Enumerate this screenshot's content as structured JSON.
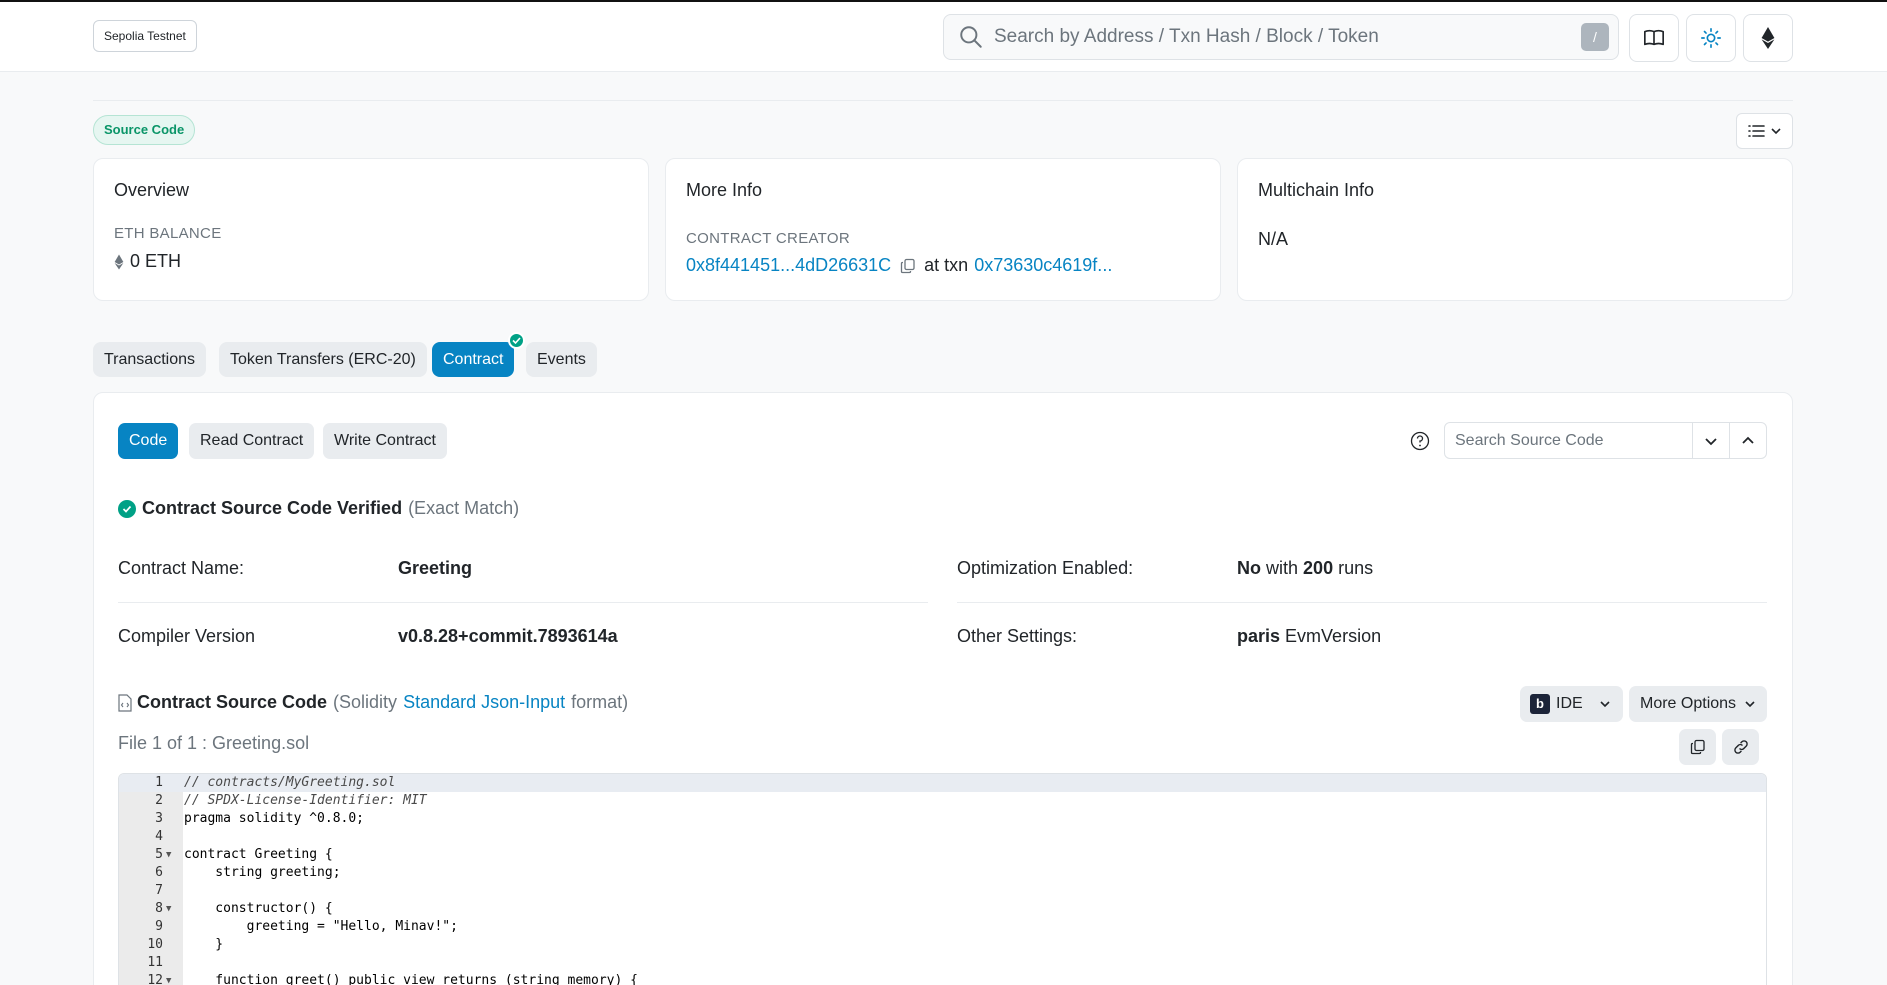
{
  "header": {
    "network": "Sepolia Testnet",
    "search_placeholder": "Search by Address / Txn Hash / Block / Token",
    "search_shortcut": "/"
  },
  "badge": {
    "source_code": "Source Code"
  },
  "cards": {
    "overview": {
      "title": "Overview",
      "label": "ETH BALANCE",
      "value": "0 ETH"
    },
    "more_info": {
      "title": "More Info",
      "label": "CONTRACT CREATOR",
      "creator": "0x8f441451...4dD26631C",
      "at_txn": "at txn",
      "txn": "0x73630c4619f..."
    },
    "multichain": {
      "title": "Multichain Info",
      "value": "N/A"
    }
  },
  "tabs": [
    {
      "label": "Transactions"
    },
    {
      "label": "Token Transfers (ERC-20)"
    },
    {
      "label": "Contract"
    },
    {
      "label": "Events"
    }
  ],
  "subtabs": [
    {
      "label": "Code"
    },
    {
      "label": "Read Contract"
    },
    {
      "label": "Write Contract"
    }
  ],
  "source_search_placeholder": "Search Source Code",
  "verification": {
    "title": "Contract Source Code Verified",
    "note": "(Exact Match)"
  },
  "details": {
    "contract_name_label": "Contract Name:",
    "contract_name": "Greeting",
    "optimization_label": "Optimization Enabled:",
    "optimization_value": "No",
    "optimization_with": "with",
    "optimization_runs": "200",
    "optimization_runs_word": "runs",
    "compiler_label": "Compiler Version",
    "compiler_value": "v0.8.28+commit.7893614a",
    "other_label": "Other Settings:",
    "other_value": "paris",
    "other_suffix": "EvmVersion"
  },
  "source": {
    "title": "Contract Source Code",
    "format_prefix": "(Solidity",
    "format_link": "Standard Json-Input",
    "format_suffix": "format)",
    "ide_label": "IDE",
    "more_options": "More Options",
    "file_label": "File 1 of 1 : Greeting.sol"
  },
  "code_lines": [
    {
      "n": "1",
      "text": "// contracts/MyGreeting.sol"
    },
    {
      "n": "2",
      "text": "// SPDX-License-Identifier: MIT"
    },
    {
      "n": "3",
      "text": "pragma solidity ^0.8.0;"
    },
    {
      "n": "4",
      "text": ""
    },
    {
      "n": "5",
      "text": "contract Greeting {"
    },
    {
      "n": "6",
      "text": "    string greeting;"
    },
    {
      "n": "7",
      "text": ""
    },
    {
      "n": "8",
      "text": "    constructor() {"
    },
    {
      "n": "9",
      "text": "        greeting = \"Hello, Minav!\";"
    },
    {
      "n": "10",
      "text": "    }"
    },
    {
      "n": "11",
      "text": ""
    },
    {
      "n": "12",
      "text": "    function greet() public view returns (string memory) {"
    }
  ],
  "colors": {
    "accent": "#0784c3",
    "success": "#00a186"
  }
}
